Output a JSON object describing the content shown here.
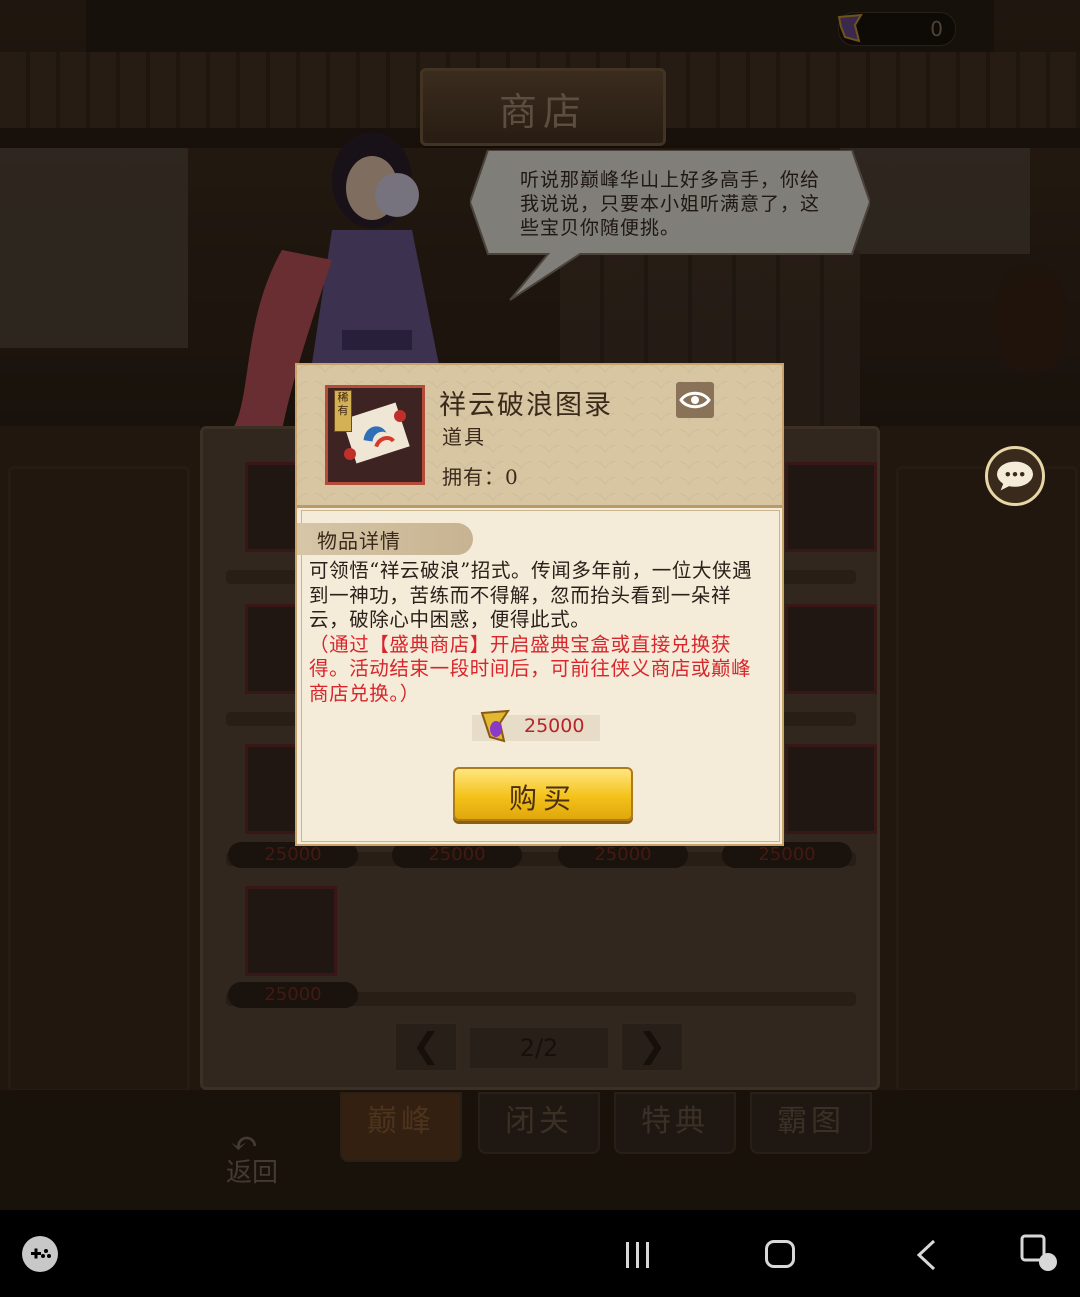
{
  "top_bar": {
    "currency_value": "0"
  },
  "shop": {
    "title": "商店",
    "npc_dialog": "听说那巅峰华山上好多高手，你给我说说，只要本小姐听满意了，这些宝贝你随便挑。",
    "background_prices": [
      "25000",
      "25000",
      "25000",
      "25000",
      "25000"
    ],
    "pager": {
      "label": "2/2",
      "prev": "❮",
      "next": "❯"
    },
    "tabs": [
      "巅峰",
      "闭关",
      "特典",
      "霸图"
    ],
    "active_tab": "巅峰",
    "back_label": "返回"
  },
  "modal": {
    "item_name": "祥云破浪图录",
    "rarity_badge": "稀有",
    "item_type": "道具",
    "owned_label": "拥有：0",
    "section_title": "物品详情",
    "description": "可领悟“祥云破浪”招式。传闻多年前，一位大侠遇到一神功，苦练而不得解，忽而抬头看到一朵祥云，破除心中困惑，便得此式。",
    "source_note": "（通过【盛典商店】开启盛典宝盒或直接兑换获得。活动结束一段时间后，可前往侠义商店或巅峰商店兑换。）",
    "cost_value": "25000",
    "buy_label": "购买",
    "accent_red": "#d8262c",
    "button_gold": "#f4c21a"
  },
  "icons": [
    "currency-crystal-icon",
    "eye-icon",
    "chat-icon",
    "scroll-item-icon",
    "game-launcher-icon",
    "recents-icon",
    "home-icon",
    "back-icon",
    "screen-capture-icon"
  ]
}
